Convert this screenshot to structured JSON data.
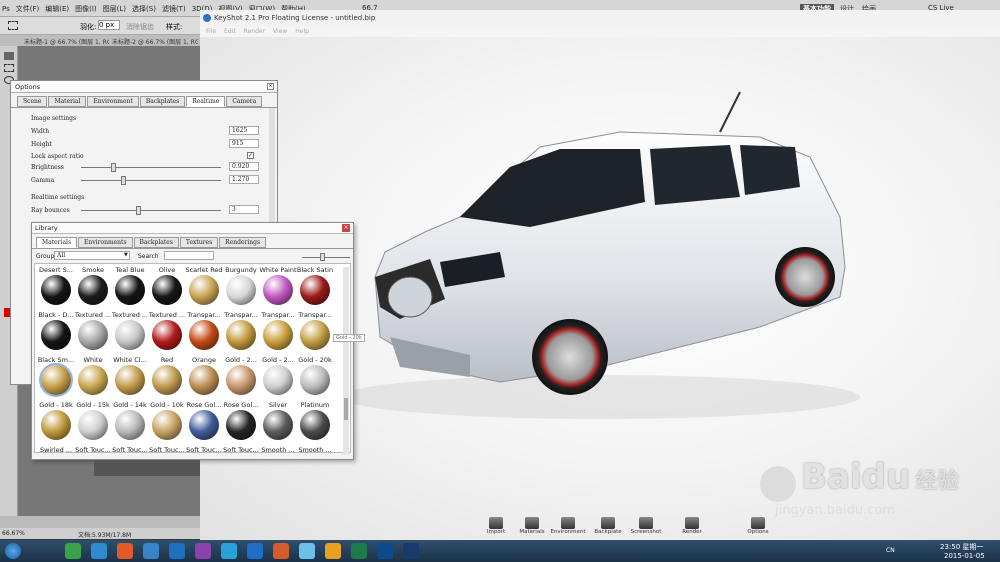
{
  "photoshop": {
    "menu": [
      "Ps",
      "文件(F)",
      "编辑(E)",
      "图像(I)",
      "图层(L)",
      "选择(S)",
      "滤镜(T)",
      "3D(D)",
      "视图(V)",
      "窗口(W)",
      "帮助(H)"
    ],
    "zoom": "66.7",
    "workspace": "基本功能",
    "workspace2": "设计",
    "workspace3": "绘画",
    "cs_live": "CS Live",
    "feather_label": "羽化:",
    "feather_value": "0 px",
    "antialias": "消除锯齿",
    "style_label": "样式:",
    "doc_tab1": "未标题-1 @ 66.7% (图层 1, RGB/8) *",
    "doc_tab2": "未标题-2 @ 66.7% (图层 1, RGB/8) *",
    "status_zoom": "66.67%",
    "status_doc": "文档:5.93M/17.8M"
  },
  "keyshot": {
    "title": "KeyShot 2.1 Pro Floating License - untitled.bip",
    "menu": [
      "File",
      "Edit",
      "Render",
      "View",
      "Help"
    ],
    "toolbar": [
      {
        "label": "Import",
        "icon": "import-icon"
      },
      {
        "label": "Materials",
        "icon": "materials-icon"
      },
      {
        "label": "Environment",
        "icon": "environment-icon"
      },
      {
        "label": "Backplate",
        "icon": "backplate-icon"
      },
      {
        "label": "Screenshot",
        "icon": "screenshot-icon"
      },
      {
        "label": "Render",
        "icon": "render-icon"
      },
      {
        "label": "Options",
        "icon": "options-icon"
      }
    ]
  },
  "options_window": {
    "title": "Options",
    "tabs": [
      "Scene",
      "Material",
      "Environment",
      "Backplates",
      "Realtime",
      "Camera"
    ],
    "active_tab": "Realtime",
    "section_image": "Image settings",
    "width_label": "Width",
    "width_value": "1625",
    "height_label": "Height",
    "height_value": "915",
    "lock_label": "Lock aspect ratio",
    "brightness_label": "Brightness",
    "brightness_value": "0.920",
    "gamma_label": "Gamma",
    "gamma_value": "1.270",
    "section_realtime": "Realtime settings",
    "ray_label": "Ray bounces",
    "ray_value": "3"
  },
  "library_window": {
    "title": "Library",
    "tabs": [
      "Materials",
      "Environments",
      "Backplates",
      "Textures",
      "Renderings"
    ],
    "active_tab": "Materials",
    "group_label": "Group",
    "group_value": "All",
    "search_label": "Search",
    "tooltip": "Gold - 20k",
    "rows": [
      {
        "top": [
          "Desert S...",
          "Smoke",
          "Teal Blue",
          "Olive",
          "Scarlet Red",
          "Burgundy",
          "White Paint",
          "Black Satin"
        ],
        "balls": [
          "#151515",
          "#1c1c1c",
          "#151515",
          "#161616",
          "#c9a452",
          "#d8d8d8",
          "#c259c0",
          "#9b1a1a"
        ]
      },
      {
        "top": [
          "Black - D...",
          "Textured ...",
          "Textured ...",
          "Textured ...",
          "Transpar...",
          "Transpar...",
          "Transpar...",
          "Transpar..."
        ],
        "balls": [
          "#141414",
          "#a8a8a8",
          "#c8c8c8",
          "#b01b1b",
          "#c44a15",
          "#c39a3c",
          "#c9a03e",
          "#c49e45"
        ]
      },
      {
        "top": [
          "Black Sm...",
          "White",
          "White Cl...",
          "Red",
          "Orange",
          "Gold - 2...",
          "Gold - 2...",
          "Gold - 20k"
        ],
        "balls": [
          "#c6a04a",
          "#caa651",
          "#c49c4c",
          "#bf9a4f",
          "#bb8e52",
          "#c7976d",
          "#cfcfcf",
          "#bcbcbc"
        ]
      },
      {
        "top": [
          "Gold - 18k",
          "Gold - 15k",
          "Gold - 14k",
          "Gold - 10k",
          "Rose Gol...",
          "Rose Gol...",
          "Silver",
          "Platinum"
        ],
        "balls": [
          "#bf9a3d",
          "#cfcfcf",
          "#b9b9b9",
          "#c8a263",
          "#3f5d9a",
          "#262626",
          "#5c5c5c",
          "#4c4c4c"
        ]
      },
      {
        "top": [
          "Swirled ...",
          "Soft Touc...",
          "Soft Touc...",
          "Soft Touc...",
          "Soft Touc...",
          "Soft Touc...",
          "Smooth ...",
          "Smooth ..."
        ],
        "balls": []
      }
    ]
  },
  "taskbar": {
    "lang": "CN",
    "time": "23:50 星期一",
    "date": "2015-01-05"
  },
  "watermark": {
    "brand": "Bai",
    "brand2": "du",
    "brand3": "经验",
    "url": "jingyan.baidu.com"
  }
}
